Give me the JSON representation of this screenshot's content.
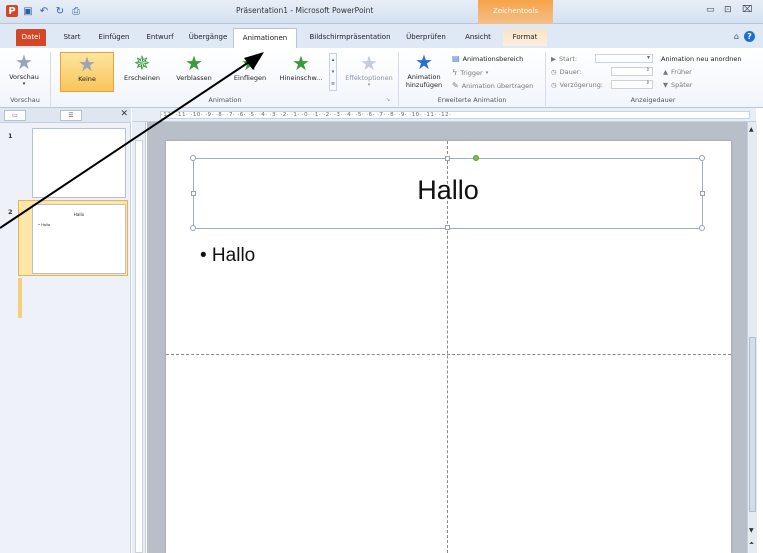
{
  "window": {
    "title": "Präsentation1 - Microsoft PowerPoint",
    "context_tab_title": "Zeichentools",
    "ppt_logo": "P",
    "qat_icons": [
      "save-icon",
      "undo-icon",
      "redo-icon",
      "print-icon"
    ]
  },
  "tabs": [
    "Datei",
    "Start",
    "Einfügen",
    "Entwurf",
    "Übergänge",
    "Animationen",
    "Bildschirmpräsentation",
    "Überprüfen",
    "Ansicht",
    "Format"
  ],
  "active_tab": "Animationen",
  "ribbon": {
    "preview": {
      "label": "Vorschau",
      "group": "Vorschau"
    },
    "animation_group": "Animation",
    "animations": [
      "Keine",
      "Erscheinen",
      "Verblassen",
      "Einfliegen",
      "Hineinschw..."
    ],
    "selected_animation": "Keine",
    "effect_options": "Effektoptionen",
    "advanced": {
      "add_label_1": "Animation",
      "add_label_2": "hinzufügen",
      "pane": "Animationsbereich",
      "trigger": "Trigger",
      "painter": "Animation übertragen",
      "group": "Erweiterte Animation"
    },
    "timing": {
      "start": "Start:",
      "duration": "Dauer:",
      "delay": "Verzögerung:",
      "reorder": "Animation neu anordnen",
      "earlier": "Früher",
      "later": "Später",
      "group": "Anzeigedauer"
    }
  },
  "slides_panel": {
    "slide_numbers": [
      "1",
      "2"
    ],
    "thumb2_title": "Hallo",
    "thumb2_bullet": "• Hallo"
  },
  "ruler_text": "·12·  ·11·  ·10·  ·9·  ·8·  ·7·  ·6·  ·5·  ·4·  ·3·  ·2·  ·1·  ·0·  ·1·  ·2·  ·3·  ·4·  ·5·  ·6·  ·7·  ·8·  ·9·  ·10·  ·11·  ·12·",
  "slide": {
    "title": "Hallo",
    "bullet": "• Hallo"
  }
}
